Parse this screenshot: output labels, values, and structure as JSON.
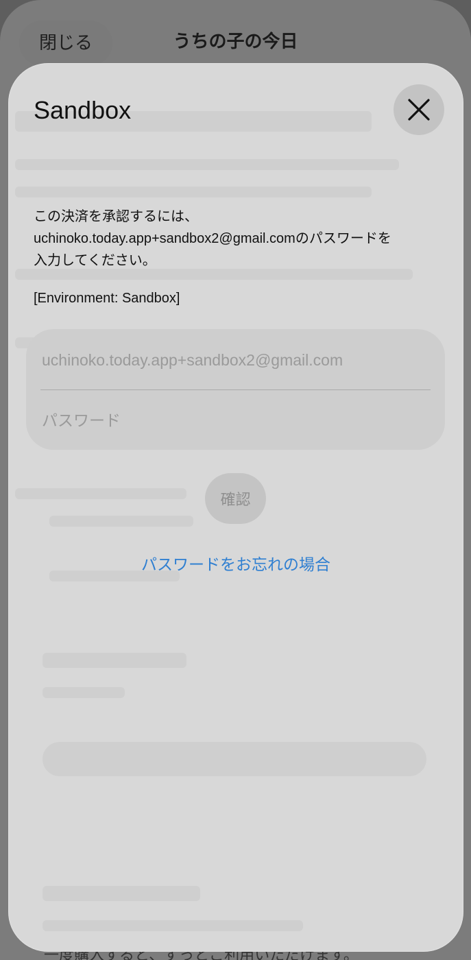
{
  "background": {
    "close_label": "閉じる",
    "title": "うちの子の今日",
    "footer_text": "一度購入すると、ずっとご利用いただけます。"
  },
  "modal": {
    "title": "Sandbox",
    "message_line1": "この決済を承認するには、",
    "message_line2": "uchinoko.today.app+sandbox2@gmail.comのパスワードを",
    "message_line3": "入力してください。",
    "environment": "[Environment: Sandbox]",
    "email_placeholder": "uchinoko.today.app+sandbox2@gmail.com",
    "password_placeholder": "パスワード",
    "confirm_label": "確認",
    "forgot_label": "パスワードをお忘れの場合"
  },
  "colors": {
    "link": "#2f7fd1",
    "modal_bg": "#d8d8d8",
    "backdrop": "#5e5e5e"
  },
  "icons": {
    "close": "close-icon"
  }
}
